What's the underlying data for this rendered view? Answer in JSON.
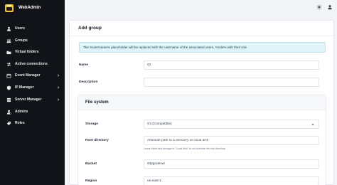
{
  "app": {
    "name": "WebAdmin"
  },
  "sidebar": {
    "items": [
      {
        "label": "Users",
        "icon": "users-icon",
        "has_children": false
      },
      {
        "label": "Groups",
        "icon": "groups-icon",
        "has_children": false
      },
      {
        "label": "Virtual folders",
        "icon": "folder-icon",
        "has_children": false
      },
      {
        "label": "Active connections",
        "icon": "exchange-icon",
        "has_children": false
      },
      {
        "label": "Event Manager",
        "icon": "calendar-icon",
        "has_children": true
      },
      {
        "label": "IP Manager",
        "icon": "shield-icon",
        "has_children": true
      },
      {
        "label": "Server Manager",
        "icon": "server-icon",
        "has_children": true
      },
      {
        "label": "Admins",
        "icon": "admin-icon",
        "has_children": false
      },
      {
        "label": "Roles",
        "icon": "roles-icon",
        "has_children": false
      }
    ]
  },
  "header": {
    "theme_icon": "sun-icon",
    "user_icon": "user-icon"
  },
  "page": {
    "title": "Add group",
    "notice": "The %username% placeholder will be replaced with the username of the associated users, %role% with their role",
    "name_label": "Name",
    "name_value": "s3",
    "description_label": "Description",
    "description_value": ""
  },
  "filesystem": {
    "title": "File system",
    "storage_label": "Storage",
    "storage_value": "S3 (Compatible)",
    "root_label": "Root directory",
    "root_placeholder": "Absolute path to a directory on local disk",
    "root_hint": "Leave blank and storage to \"Local disk\" to not override the root directory.",
    "bucket_label": "Bucket",
    "bucket_value": "sftpgodever",
    "region_label": "Region",
    "region_value": "us-east-1"
  },
  "colors": {
    "sidebar_bg": "#111318",
    "notice_bg": "#dff3f8",
    "logo": "#f2c230"
  }
}
